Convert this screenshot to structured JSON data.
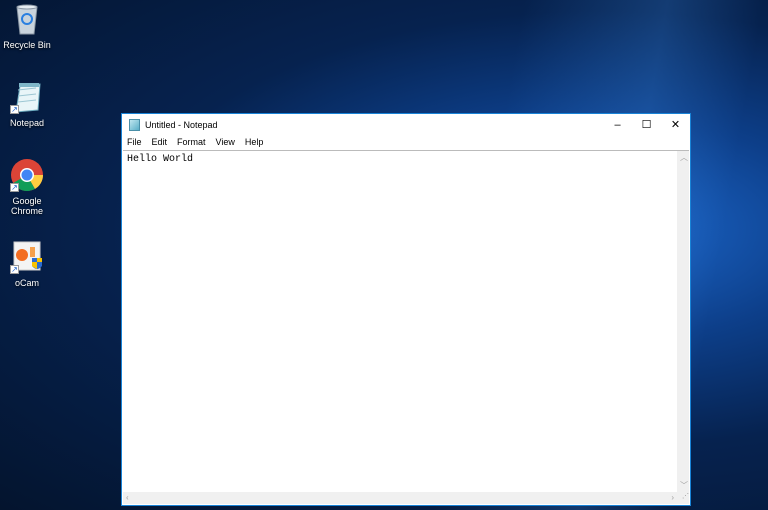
{
  "desktop": {
    "icons": [
      {
        "label": "Recycle Bin",
        "icon": "recycle-bin-icon"
      },
      {
        "label": "Notepad",
        "icon": "notepad-icon"
      },
      {
        "label": "Google Chrome",
        "icon": "chrome-icon"
      },
      {
        "label": "oCam",
        "icon": "ocam-icon"
      }
    ]
  },
  "window": {
    "title": "Untitled - Notepad",
    "controls": {
      "minimize": "–",
      "maximize": "☐",
      "close": "✕"
    },
    "menu": [
      "File",
      "Edit",
      "Format",
      "View",
      "Help"
    ],
    "content": "Hello World"
  }
}
